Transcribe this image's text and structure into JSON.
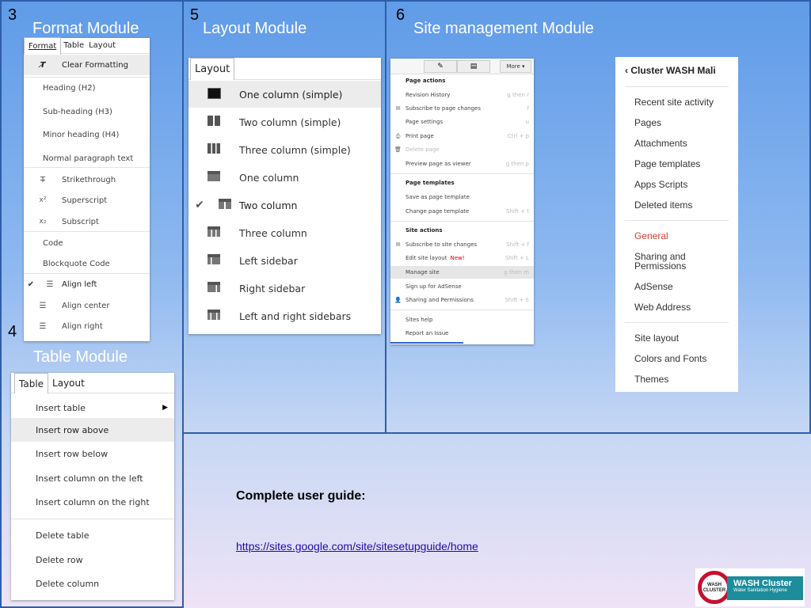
{
  "panels": {
    "format": {
      "number": "3",
      "title": "Format Module"
    },
    "table": {
      "number": "4",
      "title": "Table Module"
    },
    "layout": {
      "number": "5",
      "title": "Layout Module"
    },
    "site": {
      "number": "6",
      "title": "Site management Module"
    }
  },
  "format_menu": {
    "bar": [
      "Format",
      "Table",
      "Layout"
    ],
    "items": [
      {
        "label": "Clear Formatting",
        "icon": "clear-format-icon"
      },
      {
        "label": "Heading (H2)"
      },
      {
        "label": "Sub-heading (H3)"
      },
      {
        "label": "Minor heading (H4)"
      },
      {
        "label": "Normal paragraph text"
      },
      {
        "label": "Strikethrough",
        "icon": "strikethrough-icon"
      },
      {
        "label": "Superscript",
        "icon": "superscript-icon"
      },
      {
        "label": "Subscript",
        "icon": "subscript-icon"
      },
      {
        "label": "Code"
      },
      {
        "label": "Blockquote Code"
      },
      {
        "label": "Align left",
        "icon": "align-left-icon",
        "checked": true
      },
      {
        "label": "Align center",
        "icon": "align-center-icon"
      },
      {
        "label": "Align right",
        "icon": "align-right-icon"
      }
    ]
  },
  "table_menu": {
    "bar": [
      "Table",
      "Layout"
    ],
    "items": [
      "Insert table",
      "Insert row above",
      "Insert row below",
      "Insert column on the left",
      "Insert column on the right",
      "Delete table",
      "Delete row",
      "Delete column"
    ]
  },
  "layout_menu": {
    "bar": "Layout",
    "items": [
      "One column (simple)",
      "Two column (simple)",
      "Three column (simple)",
      "One column",
      "Two column",
      "Three column",
      "Left sidebar",
      "Right sidebar",
      "Left and right sidebars"
    ]
  },
  "site_menu": {
    "toolbar": {
      "more": "More"
    },
    "sections": [
      {
        "header": "Page actions",
        "items": [
          {
            "label": "Revision History",
            "shortcut": "g then r"
          },
          {
            "label": "Subscribe to page changes",
            "shortcut": "f",
            "icon": "envelope-icon"
          },
          {
            "label": "Page settings",
            "shortcut": "u"
          },
          {
            "label": "Print page",
            "shortcut": "Ctrl + p",
            "icon": "printer-icon"
          },
          {
            "label": "Delete page",
            "shortcut": "",
            "icon": "trash-icon",
            "disabled": true
          },
          {
            "label": "Preview page as viewer",
            "shortcut": "g then p"
          }
        ]
      },
      {
        "header": "Page templates",
        "items": [
          {
            "label": "Save as page template",
            "shortcut": ""
          },
          {
            "label": "Change page template",
            "shortcut": "Shift + t"
          }
        ]
      },
      {
        "header": "Site actions",
        "items": [
          {
            "label": "Subscribe to site changes",
            "shortcut": "Shift + f",
            "icon": "envelope-icon"
          },
          {
            "label": "Edit site layout",
            "badge": "New!",
            "shortcut": "Shift + L"
          },
          {
            "label": "Manage site",
            "shortcut": "g then m",
            "highlight": true
          },
          {
            "label": "Sign up for AdSense",
            "shortcut": ""
          },
          {
            "label": "Sharing and Permissions",
            "shortcut": "Shift + S",
            "icon": "add-person-icon"
          }
        ]
      },
      {
        "header": "",
        "items": [
          {
            "label": "Sites help",
            "shortcut": ""
          },
          {
            "label": "Report an Issue",
            "shortcut": ""
          }
        ]
      }
    ]
  },
  "manage_nav": {
    "back": "Cluster WASH Mali",
    "group1": [
      "Recent site activity",
      "Pages",
      "Attachments",
      "Page templates",
      "Apps Scripts",
      "Deleted items"
    ],
    "group2": [
      "General",
      "Sharing and Permissions",
      "AdSense",
      "Web Address"
    ],
    "group3": [
      "Site layout",
      "Colors and Fonts",
      "Themes"
    ],
    "accent": "#d23f31"
  },
  "guide": {
    "label": "Complete user guide:",
    "url": "https://sites.google.com/site/sitesetupguide/home"
  },
  "logo": {
    "circle_text": "WASH CLUSTER",
    "name": "WASH Cluster",
    "tagline": "Water Sanitation Hygiene"
  },
  "colors": {
    "title_white": "#ffffff",
    "border": "#2e5ea8",
    "link": "#1a0dab"
  }
}
